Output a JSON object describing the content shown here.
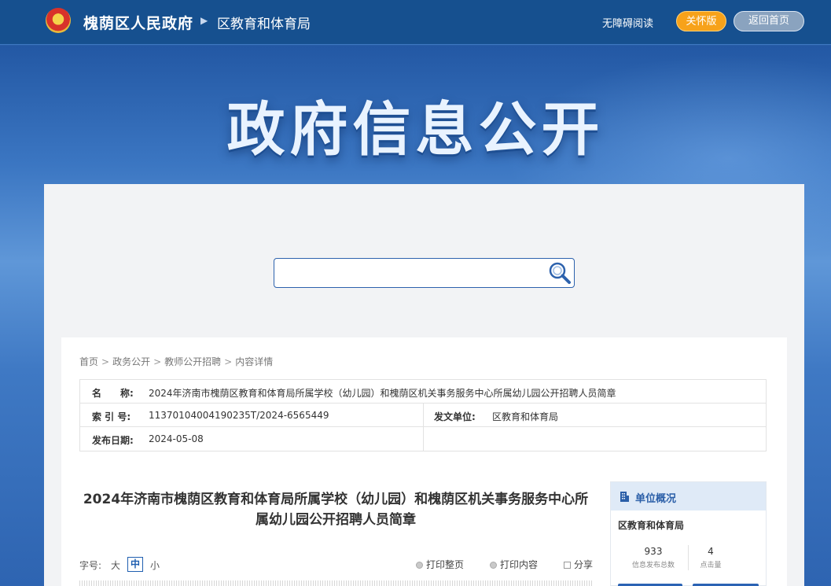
{
  "header": {
    "site_name": "槐荫区人民政府",
    "dept_name": "区教育和体育局",
    "accessibility": "无障碍阅读",
    "care_mode": "关怀版",
    "back_home": "返回首页"
  },
  "banner": {
    "title": "政府信息公开"
  },
  "search": {
    "placeholder": ""
  },
  "breadcrumb": [
    "首页",
    "政务公开",
    "教师公开招聘",
    "内容详情"
  ],
  "meta": {
    "name_label": "名　　称:",
    "name_value": "2024年济南市槐荫区教育和体育局所属学校（幼儿园）和槐荫区机关事务服务中心所属幼儿园公开招聘人员简章",
    "index_label": "索 引 号:",
    "index_value": "11370104004190235T/2024-6565449",
    "issuer_label": "发文单位:",
    "issuer_value": "区教育和体育局",
    "date_label": "发布日期:",
    "date_value": "2024-05-08"
  },
  "article": {
    "title": "2024年济南市槐荫区教育和体育局所属学校（幼儿园）和槐荫区机关事务服务中心所属幼儿园公开招聘人员简章"
  },
  "font_size": {
    "label": "字号:",
    "large": "大",
    "medium": "中",
    "small": "小"
  },
  "tools": {
    "print_page": "打印整页",
    "print_content": "打印内容",
    "share": "分享"
  },
  "side": {
    "heading": "单位概况",
    "dept": "区教育和体育局",
    "total_num": "933",
    "total_label": "信息发布总数",
    "clicks_num": "4",
    "clicks_label": "点击量"
  }
}
